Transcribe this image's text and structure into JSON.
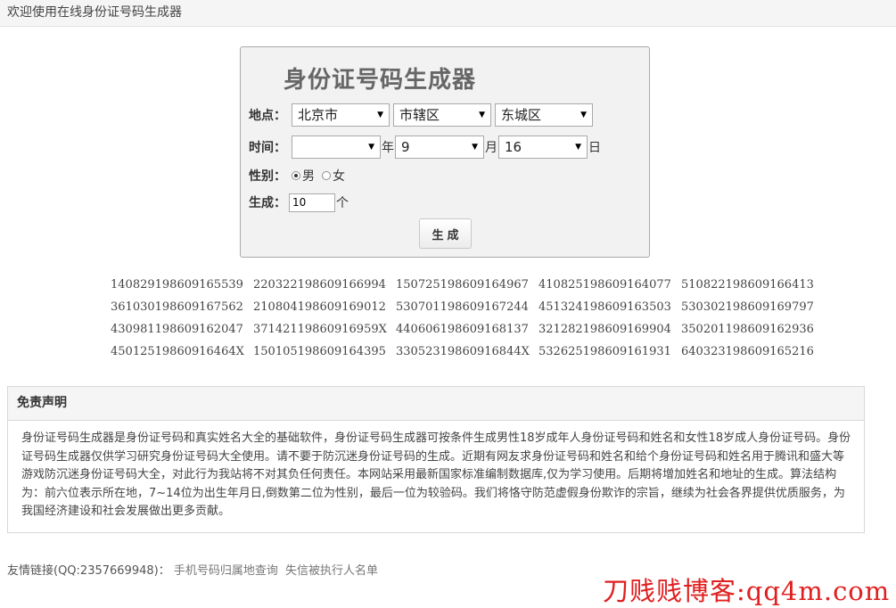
{
  "topbar": {
    "welcome": "欢迎使用在线身份证号码生成器"
  },
  "generator": {
    "title": "身份证号码生成器",
    "location": {
      "label": "地点：",
      "province": "北京市",
      "city": "市辖区",
      "district": "东城区"
    },
    "time": {
      "label": "时间：",
      "year": "",
      "year_unit": "年",
      "month": "9",
      "month_unit": "月",
      "day": "16",
      "day_unit": "日"
    },
    "gender": {
      "label": "性别：",
      "male": "男",
      "female": "女",
      "selected": "男"
    },
    "count": {
      "label": "生成：",
      "value": "10",
      "unit": "个"
    },
    "button_label": "生成"
  },
  "results": [
    "140829198609165539",
    "220322198609166994",
    "150725198609164967",
    "410825198609164077",
    "510822198609166413",
    "361030198609167562",
    "210804198609169012",
    "530701198609167244",
    "451324198609163503",
    "530302198609169797",
    "430981198609162047",
    "37142119860916959X",
    "440606198609168137",
    "321282198609169904",
    "350201198609162936",
    "45012519860916464X",
    "150105198609164395",
    "33052319860916844X",
    "532625198609161931",
    "640323198609165216"
  ],
  "disclaimer": {
    "title": "免责声明",
    "body": "身份证号码生成器是身份证号码和真实姓名大全的基础软件，身份证号码生成器可按条件生成男性18岁成年人身份证号码和姓名和女性18岁成人身份证号码。身份证号码生成器仅供学习研究身份证号码大全使用。请不要于防沉迷身份证号码的生成。近期有网友求身份证号码和姓名和给个身份证号码和姓名用于腾讯和盛大等游戏防沉迷身份证号码大全，对此行为我站将不对其负任何责任。本网站采用最新国家标准编制数据库,仅为学习使用。后期将增加姓名和地址的生成。算法结构为：前六位表示所在地，7~14位为出生年月日,倒数第二位为性别，最后一位为较验码。我们将恪守防范虚假身份欺诈的宗旨，继续为社会各界提供优质服务，为我国经济建设和社会发展做出更多贡献。"
  },
  "friends": {
    "label": "友情链接(QQ:2357669948)：",
    "links": [
      "手机号码归属地查询",
      "失信被执行人名单"
    ]
  },
  "watermark": "刀贱贱博客:qq4m.com"
}
